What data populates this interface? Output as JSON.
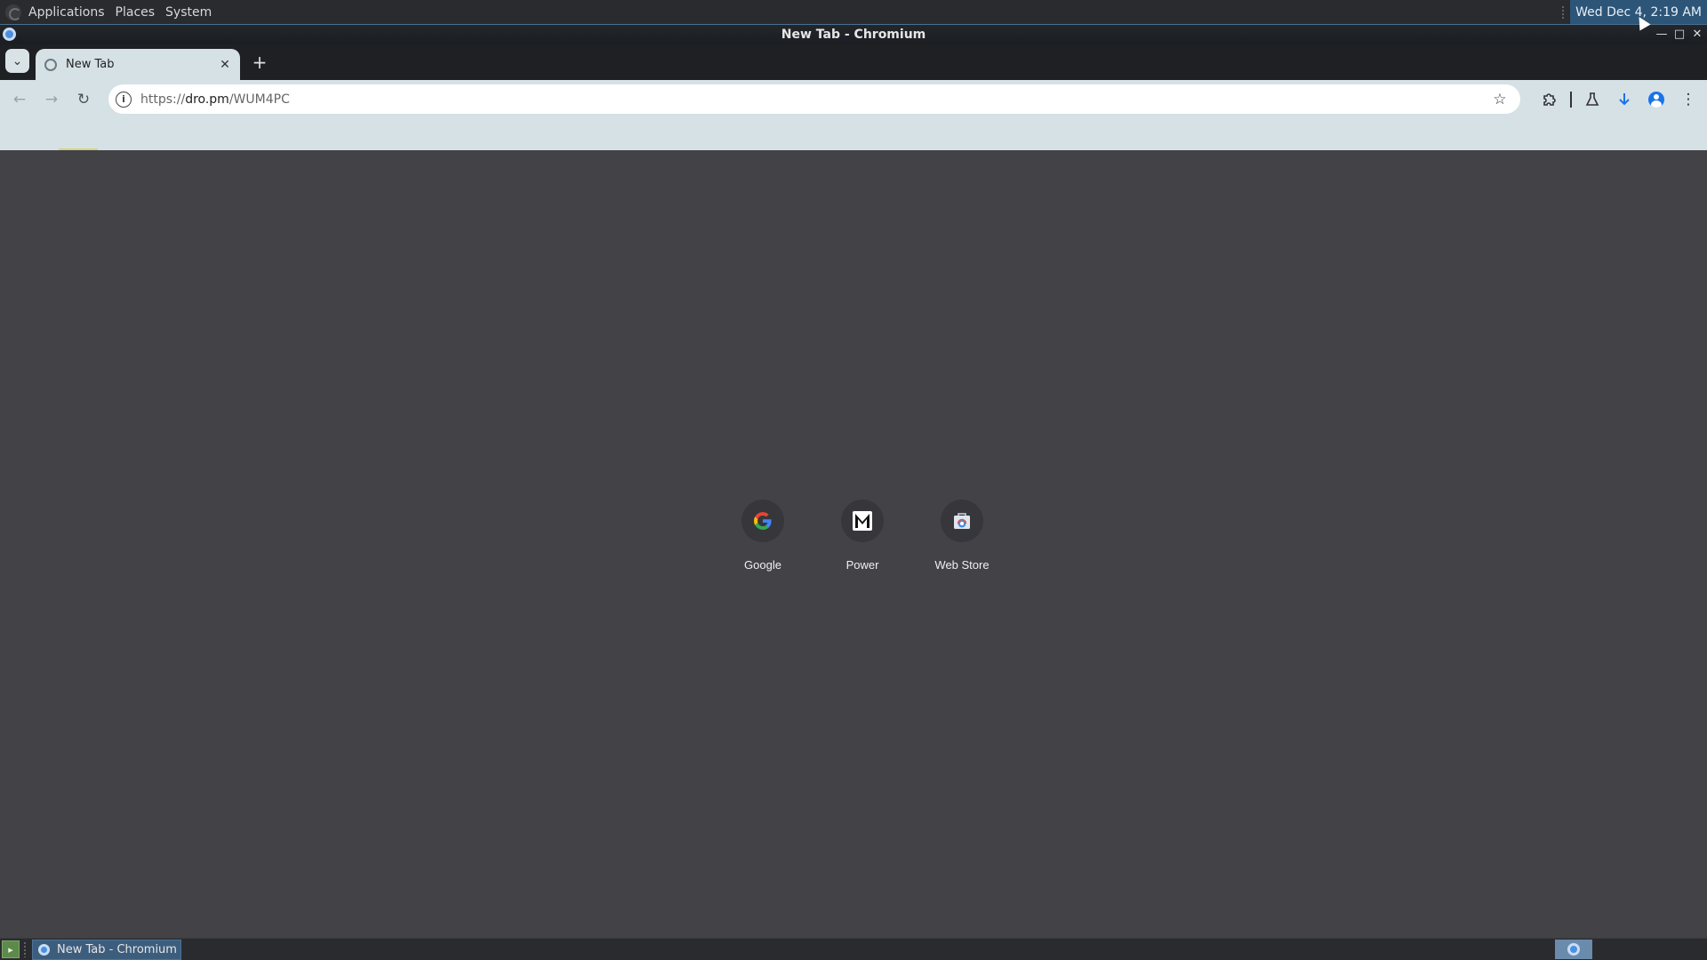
{
  "desktop_panel": {
    "menus": [
      "Applications",
      "Places",
      "System"
    ],
    "clock": "Wed Dec  4,  2:19 AM"
  },
  "window": {
    "title": "New Tab - Chromium"
  },
  "tabs": [
    {
      "label": "New Tab",
      "active": true
    }
  ],
  "toolbar": {
    "url_scheme": "https://",
    "url_host": "dro.pm",
    "url_path": "/WUM4PC"
  },
  "new_tab_page": {
    "shortcuts": [
      {
        "label": "Google",
        "icon": "google-g-icon"
      },
      {
        "label": "Power",
        "icon": "m-logo-icon"
      },
      {
        "label": "Web Store",
        "icon": "web-store-icon"
      }
    ]
  },
  "taskbar": {
    "task_label": "New Tab - Chromium"
  },
  "colors": {
    "content_bg": "#424247",
    "toolbar_bg": "#d6e1e6",
    "accent": "#1a73e8"
  }
}
